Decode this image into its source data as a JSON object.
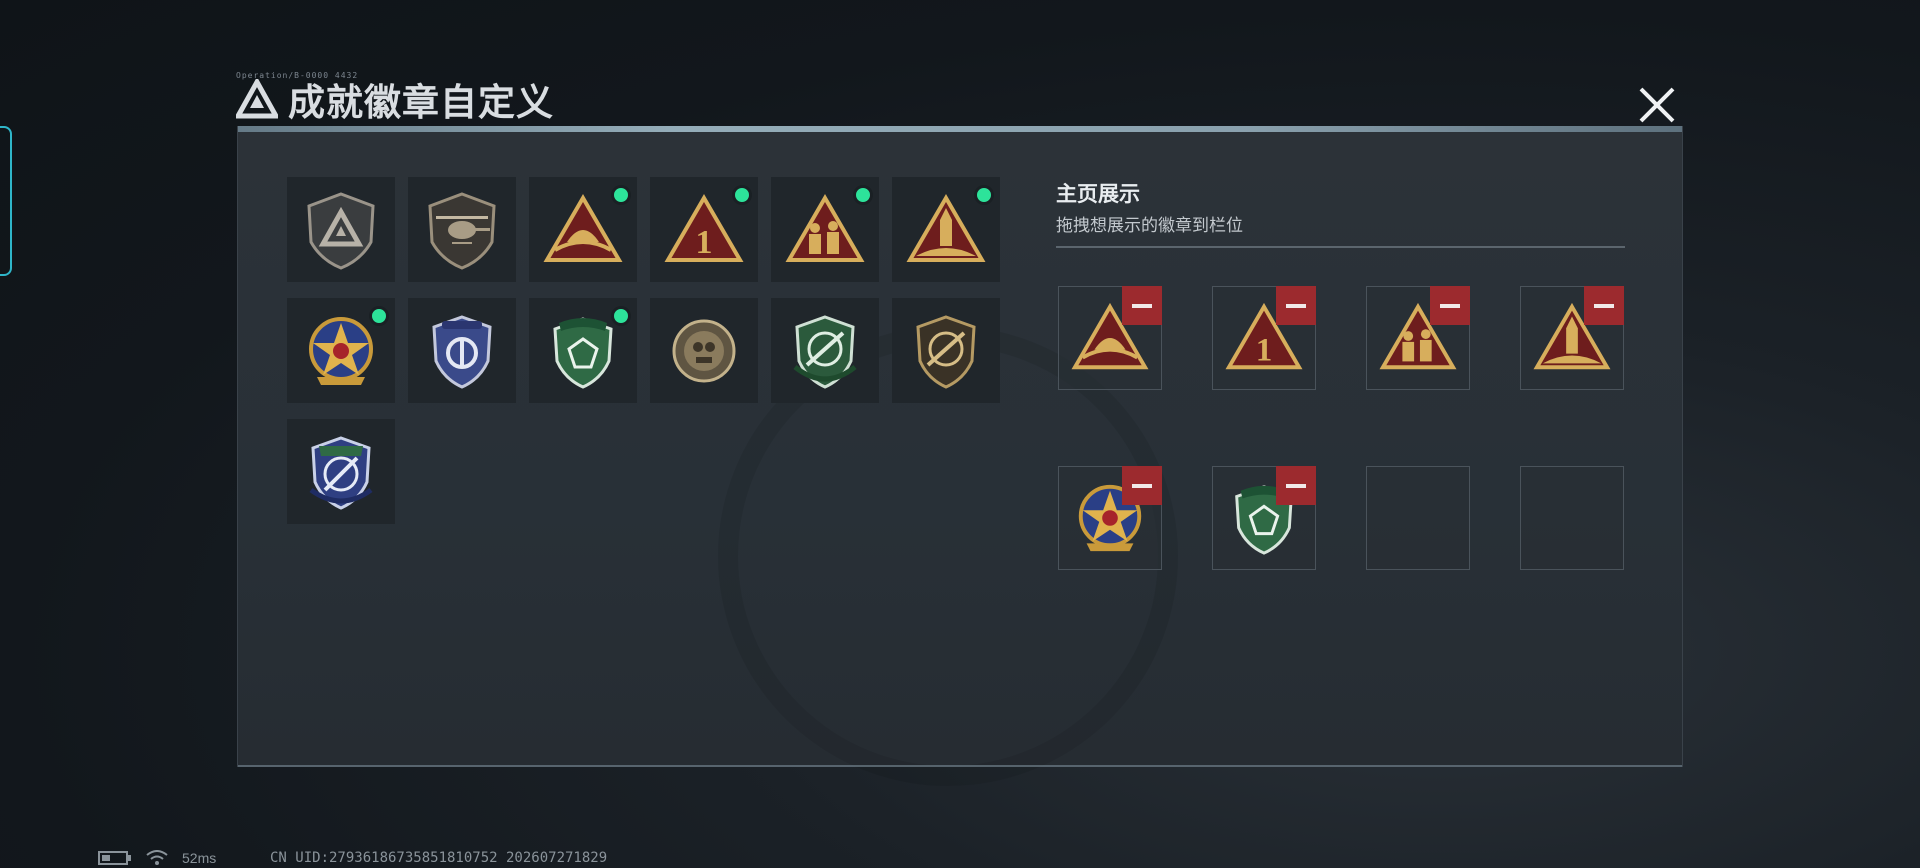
{
  "header": {
    "small_text": "Operation/B-0000 4432",
    "title": "成就徽章自定义"
  },
  "accent": "#2de39a",
  "remove_color": "#9c2a2e",
  "badges": [
    {
      "icon": "gray-triangle-shield-icon",
      "new": false
    },
    {
      "icon": "helicopter-shield-icon",
      "new": false
    },
    {
      "icon": "helmet-triangle-badge-icon",
      "new": true
    },
    {
      "icon": "number-one-triangle-badge-icon",
      "new": true
    },
    {
      "icon": "soldiers-triangle-badge-icon",
      "new": true
    },
    {
      "icon": "rocket-triangle-badge-icon",
      "new": true
    },
    {
      "icon": "star-medal-badge-icon",
      "new": true
    },
    {
      "icon": "blue-shield-badge-icon",
      "new": false
    },
    {
      "icon": "green-gem-shield-icon",
      "new": true
    },
    {
      "icon": "round-emblem-badge-icon",
      "new": false
    },
    {
      "icon": "green-rifle-shield-icon",
      "new": false
    },
    {
      "icon": "gold-rifle-shield-icon",
      "new": false
    },
    {
      "icon": "blue-knife-shield-icon",
      "new": false
    }
  ],
  "showcase": {
    "title": "主页展示",
    "subtitle": "拖拽想展示的徽章到栏位",
    "slots": [
      {
        "icon": "helmet-triangle-badge-icon",
        "filled": true
      },
      {
        "icon": "number-one-triangle-badge-icon",
        "filled": true
      },
      {
        "icon": "soldiers-triangle-badge-icon",
        "filled": true
      },
      {
        "icon": "rocket-triangle-badge-icon",
        "filled": true
      },
      {
        "icon": "star-medal-badge-icon",
        "filled": true
      },
      {
        "icon": "green-gem-shield-icon",
        "filled": true
      },
      {
        "icon": "",
        "filled": false
      },
      {
        "icon": "",
        "filled": false
      }
    ]
  },
  "status": {
    "ping": "52ms",
    "uid": "CN UID:279361867358518107​52 202607271829"
  }
}
